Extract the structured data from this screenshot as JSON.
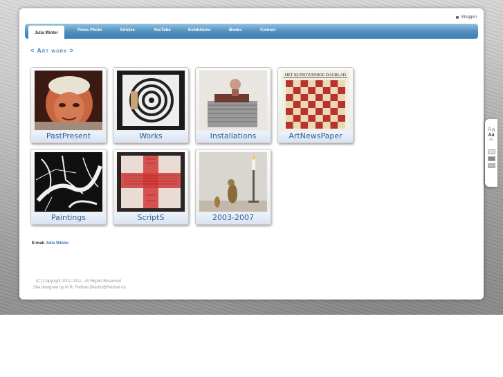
{
  "header": {
    "login_label": "Inloggen"
  },
  "nav": {
    "items": [
      {
        "label": "Julia Winter"
      },
      {
        "label": "Press Photo"
      },
      {
        "label": "Articles"
      },
      {
        "label": "YouTube"
      },
      {
        "label": "Exhibitions"
      },
      {
        "label": "Books"
      },
      {
        "label": "Contact"
      }
    ]
  },
  "section": {
    "title": "< Art work >"
  },
  "gallery": {
    "tiles": [
      {
        "label": "PastPresent"
      },
      {
        "label": "Works"
      },
      {
        "label": "Installations"
      },
      {
        "label": "ArtNewsPaper",
        "masthead": "HET KUNSTZINNIGE DAGBLAD"
      },
      {
        "label": "Paintings"
      },
      {
        "label": "ScriptS"
      },
      {
        "label": "2003-2007"
      }
    ]
  },
  "contact": {
    "prefix": "E-mail",
    "link": "Julia Winter"
  },
  "footer": {
    "copyright": "(C) Copyright 2002-2011 . All Rights Reserved",
    "designer": "Site designed by M.R. Feldsel (Martin@Feldsel.nl)"
  },
  "font_widget": {
    "large": "Aa",
    "medium": "Aa",
    "small": "Aa"
  },
  "colors": {
    "nav": "#4f8fbf",
    "link": "#3a73b6",
    "tile_label": "#2f5f96"
  }
}
